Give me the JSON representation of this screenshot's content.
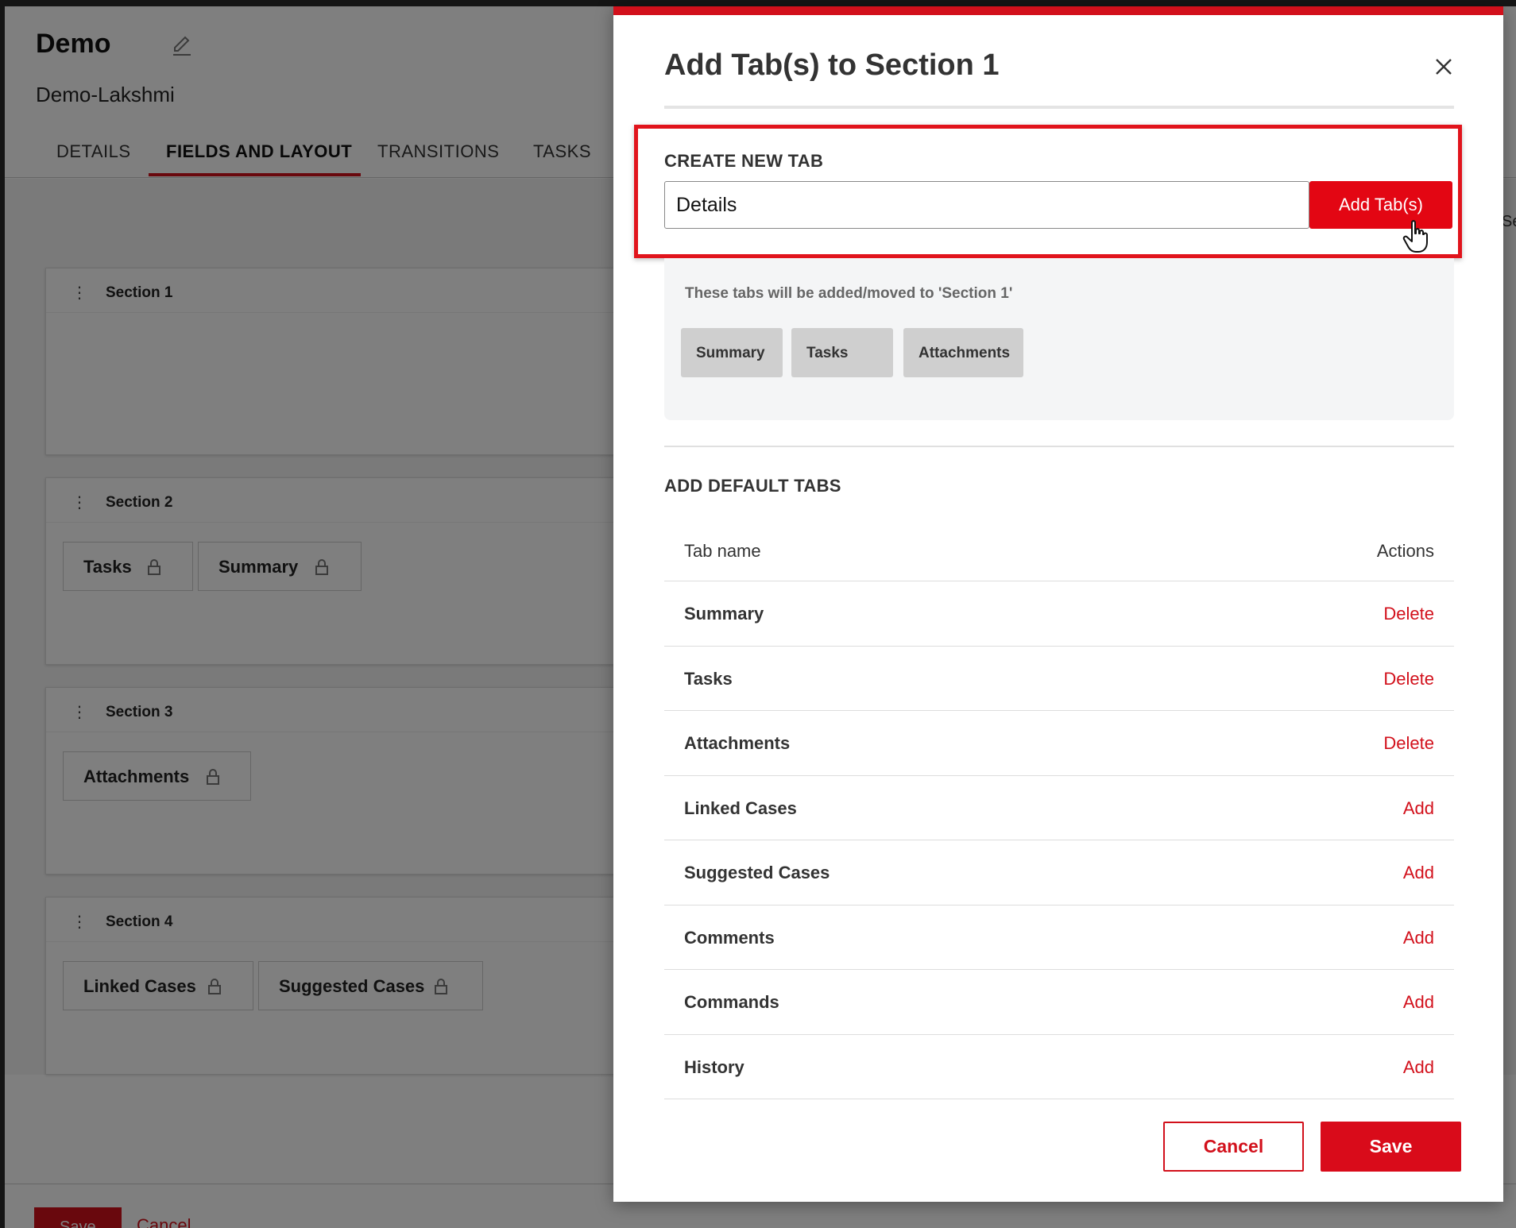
{
  "page": {
    "title": "Demo",
    "subtitle": "Demo-Lakshmi",
    "tabs": [
      {
        "label": "DETAILS"
      },
      {
        "label": "FIELDS AND LAYOUT"
      },
      {
        "label": "TRANSITIONS"
      },
      {
        "label": "TASKS"
      }
    ],
    "sections": [
      {
        "label": "Section 1",
        "chips": []
      },
      {
        "label": "Section 2",
        "chips": [
          "Tasks",
          "Summary"
        ]
      },
      {
        "label": "Section 3",
        "chips": [
          "Attachments"
        ]
      },
      {
        "label": "Section 4",
        "chips": [
          "Linked Cases",
          "Suggested Cases"
        ]
      }
    ],
    "footer": {
      "save_label": "Save",
      "cancel_label": "Cancel"
    },
    "partial_text": "Se"
  },
  "modal": {
    "title": "Add Tab(s) to Section 1",
    "create": {
      "label": "CREATE NEW TAB",
      "input_value": "Details",
      "button_label": "Add Tab(s)"
    },
    "preview": {
      "note": "These tabs will be added/moved to 'Section 1'",
      "chips": [
        "Summary",
        "Tasks",
        "Attachments"
      ]
    },
    "defaults": {
      "label": "ADD DEFAULT TABS",
      "header": {
        "name": "Tab name",
        "actions": "Actions"
      },
      "rows": [
        {
          "name": "Summary",
          "action": "Delete"
        },
        {
          "name": "Tasks",
          "action": "Delete"
        },
        {
          "name": "Attachments",
          "action": "Delete"
        },
        {
          "name": "Linked Cases",
          "action": "Add"
        },
        {
          "name": "Suggested Cases",
          "action": "Add"
        },
        {
          "name": "Comments",
          "action": "Add"
        },
        {
          "name": "Commands",
          "action": "Add"
        },
        {
          "name": "History",
          "action": "Add"
        }
      ]
    },
    "cancel_label": "Cancel",
    "save_label": "Save"
  },
  "colors": {
    "accent": "#d2101b",
    "overlay": "rgba(0,0,0,0.5)"
  }
}
